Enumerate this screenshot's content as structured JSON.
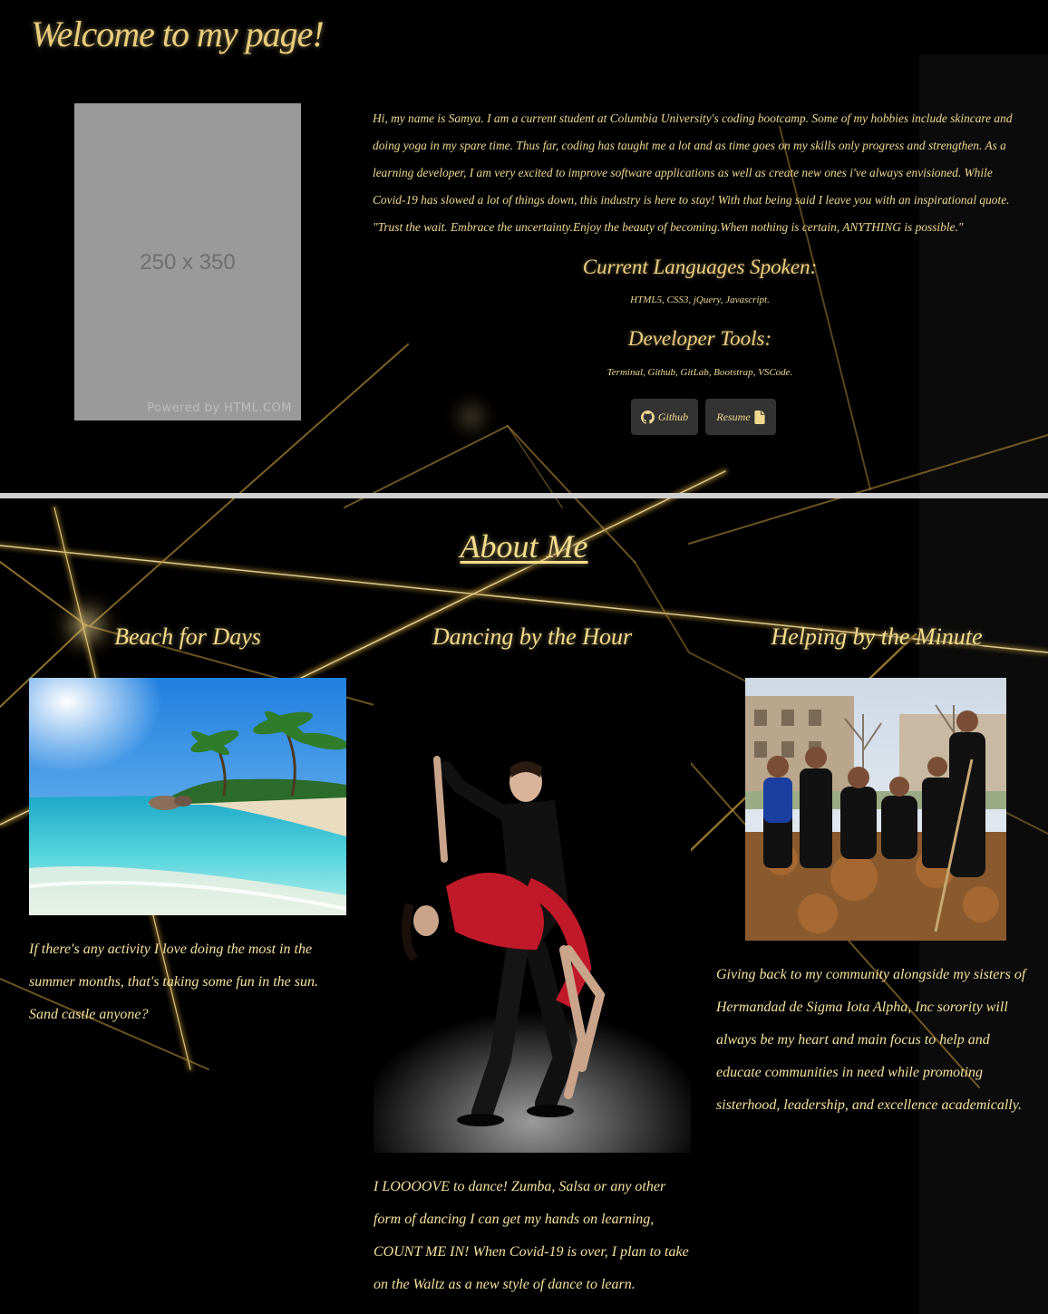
{
  "header": {
    "title": "Welcome to my page!"
  },
  "profile": {
    "placeholder_size": "250 x 350",
    "placeholder_credit": "Powered by HTML.COM",
    "bio": "Hi, my name is Samya. I am a current student at Columbia University's coding bootcamp. Some of my hobbies include skincare and doing yoga in my spare time. Thus far, coding has taught me a lot and as time goes on my skills only progress and strengthen. As a learning developer, I am very excited to improve software applications as well as create new ones i've always envisioned. While Covid-19 has slowed a lot of things down, this industry is here to stay! With that being said I leave you with an inspirational quote. \"Trust the wait. Embrace the uncertainty.Enjoy the beauty of becoming.When nothing is certain, ANYTHING is possible.\"",
    "languages_heading": "Current Languages Spoken:",
    "languages": "HTML5, CSS3, jQuery, Javascript.",
    "tools_heading": "Developer Tools:",
    "tools": "Terminal, Github, GitLab, Bootstrap, VSCode.",
    "github_button": "Github",
    "resume_button": "Resume",
    "github_icon": "github-icon",
    "resume_icon": "file-icon"
  },
  "about": {
    "heading": "About Me",
    "columns": [
      {
        "title": "Beach for Days",
        "image": "beach-photo",
        "text": "If there's any activity I love doing the most in the summer months, that's taking some fun in the sun. Sand castle anyone?"
      },
      {
        "title": "Dancing by the Hour",
        "image": "dancing-couple-photo",
        "text": "I LOOOOVE to dance! Zumba, Salsa or any other form of dancing I can get my hands on learning, COUNT ME IN! When Covid-19 is over, I plan to take on the Waltz as a new style of dance to learn."
      },
      {
        "title": "Helping by the Minute",
        "image": "sorority-volunteering-photo",
        "text": "Giving back to my community alongside my sisters of Hermandad de Sigma Iota Alpha, Inc sorority will always be my heart and main focus to help and educate communities in need while promoting sisterhood, leadership, and excellence academically."
      }
    ]
  },
  "colors": {
    "background": "#000000",
    "gold_text": "#f0d98f",
    "button_bg": "#333333",
    "divider": "#cfcfcf"
  }
}
